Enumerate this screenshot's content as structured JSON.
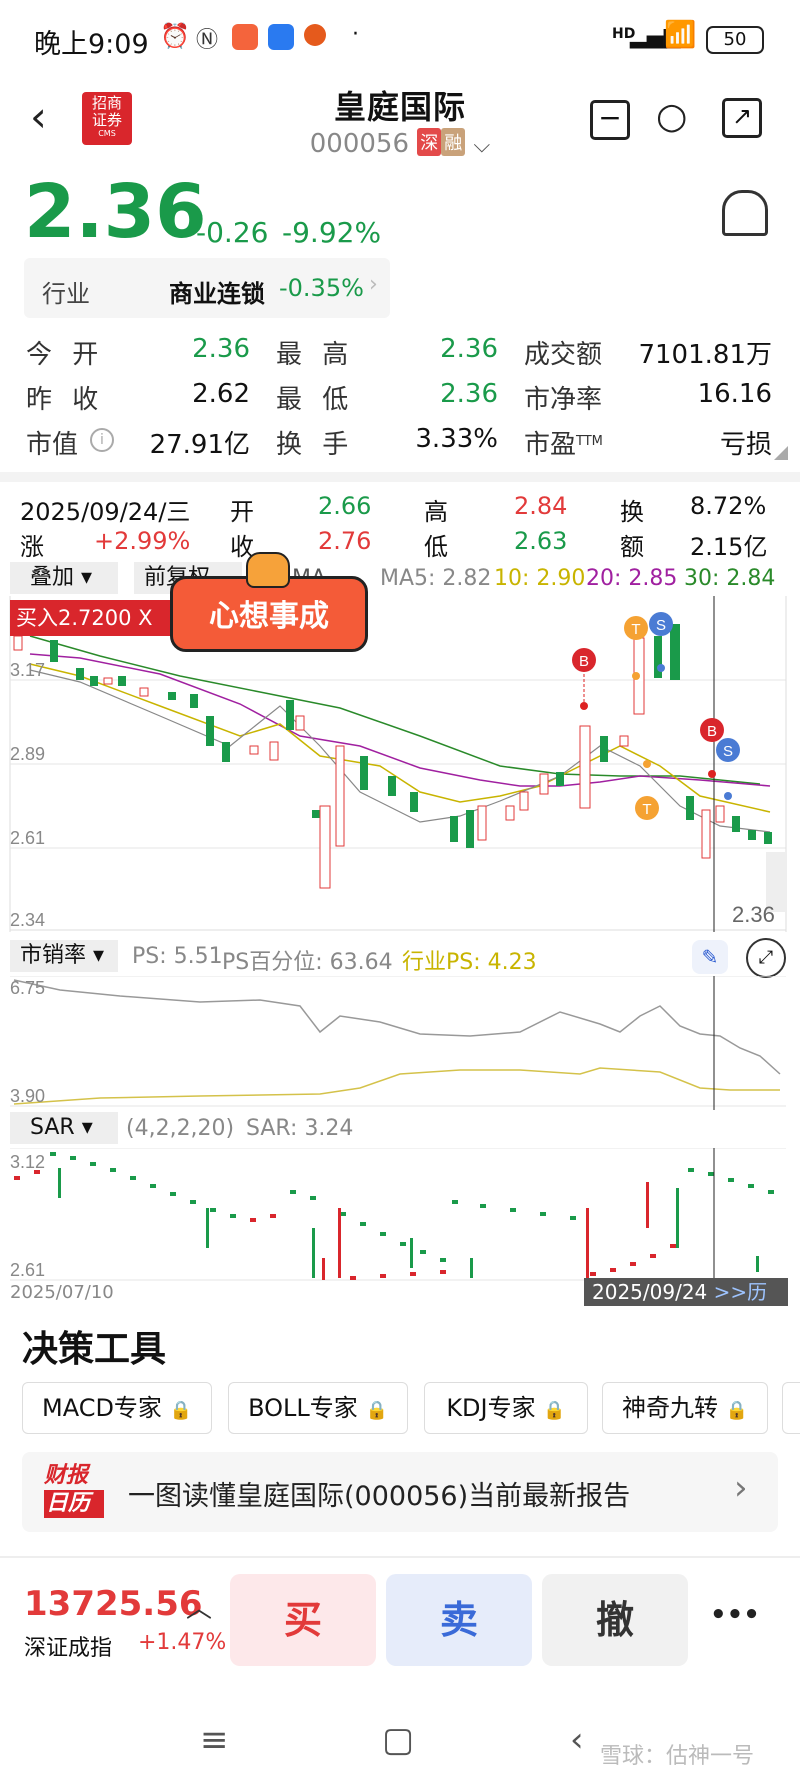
{
  "status_bar": {
    "time": "晚上9:09",
    "battery": "50",
    "network": "HD"
  },
  "header": {
    "title": "皇庭国际",
    "code": "000056",
    "tag1": "深",
    "tag2": "融",
    "logo_line1": "招商",
    "logo_line2": "证券",
    "logo_sub": "CMS"
  },
  "quote": {
    "price": "2.36",
    "change": "-0.26",
    "change_pct": "-9.92%"
  },
  "industry": {
    "label": "行业",
    "name": "商业连锁",
    "pct": "-0.35%"
  },
  "stats": {
    "open_label": "今 开",
    "open": "2.36",
    "high_label": "最 高",
    "high": "2.36",
    "amount_label": "成交额",
    "amount": "7101.81万",
    "prev_label": "昨 收",
    "prev": "2.62",
    "low_label": "最 低",
    "low": "2.36",
    "pb_label": "市净率",
    "pb": "16.16",
    "mcap_label": "市值",
    "mcap": "27.91亿",
    "turnover_label": "换 手",
    "turnover": "3.33%",
    "pe_label": "市盈",
    "pe_suffix": "TTM",
    "pe": "亏损"
  },
  "day_info": {
    "date": "2025/09/24/三",
    "open_label": "开",
    "open": "2.66",
    "high_label": "高",
    "high": "2.84",
    "turn_label": "换",
    "turn": "8.72%",
    "chg_label": "涨",
    "chg": "+2.99%",
    "close_label": "收",
    "close": "2.76",
    "low_label": "低",
    "low": "2.63",
    "amt_label": "额",
    "amt": "2.15亿"
  },
  "kline": {
    "overlay_label": "叠加",
    "adjust_label": "前复权",
    "ma_fragment": "MA",
    "ma5": "MA5: 2.82",
    "ma10": "10: 2.90",
    "ma20": "20: 2.85",
    "ma30": "30: 2.84",
    "buy_label": "买入2.7200 X",
    "sticker_text": "心想事成",
    "y_top": "3.17",
    "y_mid1": "2.89",
    "y_mid2": "2.61",
    "y_bot": "2.34",
    "last_price": "2.36",
    "marker_b": "B",
    "marker_s": "S",
    "marker_t": "T"
  },
  "ps_panel": {
    "label": "市销率",
    "ps": "PS: 5.51",
    "ps_pct": "PS百分位: 63.64",
    "industry_ps": "行业PS: 4.23",
    "y_top": "6.75",
    "y_bot": "3.90"
  },
  "sar_panel": {
    "label": "SAR",
    "params": "(4,2,2,20)",
    "sar": "SAR: 3.24",
    "y_top": "3.12",
    "y_bot": "2.61",
    "date_start": "2025/07/10",
    "date_end": "2025/09/24",
    "history_label": ">>历"
  },
  "tools": {
    "title": "决策工具",
    "items": [
      "MACD专家",
      "BOLL专家",
      "KDJ专家",
      "神奇九转"
    ]
  },
  "report": {
    "logo_line1": "财报",
    "logo_line2": "日历",
    "text": "一图读懂皇庭国际(000056)当前最新报告"
  },
  "bottom": {
    "index_value": "13725.56",
    "index_name": "深证成指",
    "index_pct": "+1.47%",
    "buy": "买",
    "sell": "卖",
    "cancel": "撤",
    "more": "•••"
  },
  "watermark": "雪球：估神一号",
  "colors": {
    "up": "#e23a3a",
    "down": "#1a9a4a",
    "buy_bg": "#fde8ea",
    "sell_bg": "#e6ecfa",
    "cancel_bg": "#f1f1f1"
  }
}
